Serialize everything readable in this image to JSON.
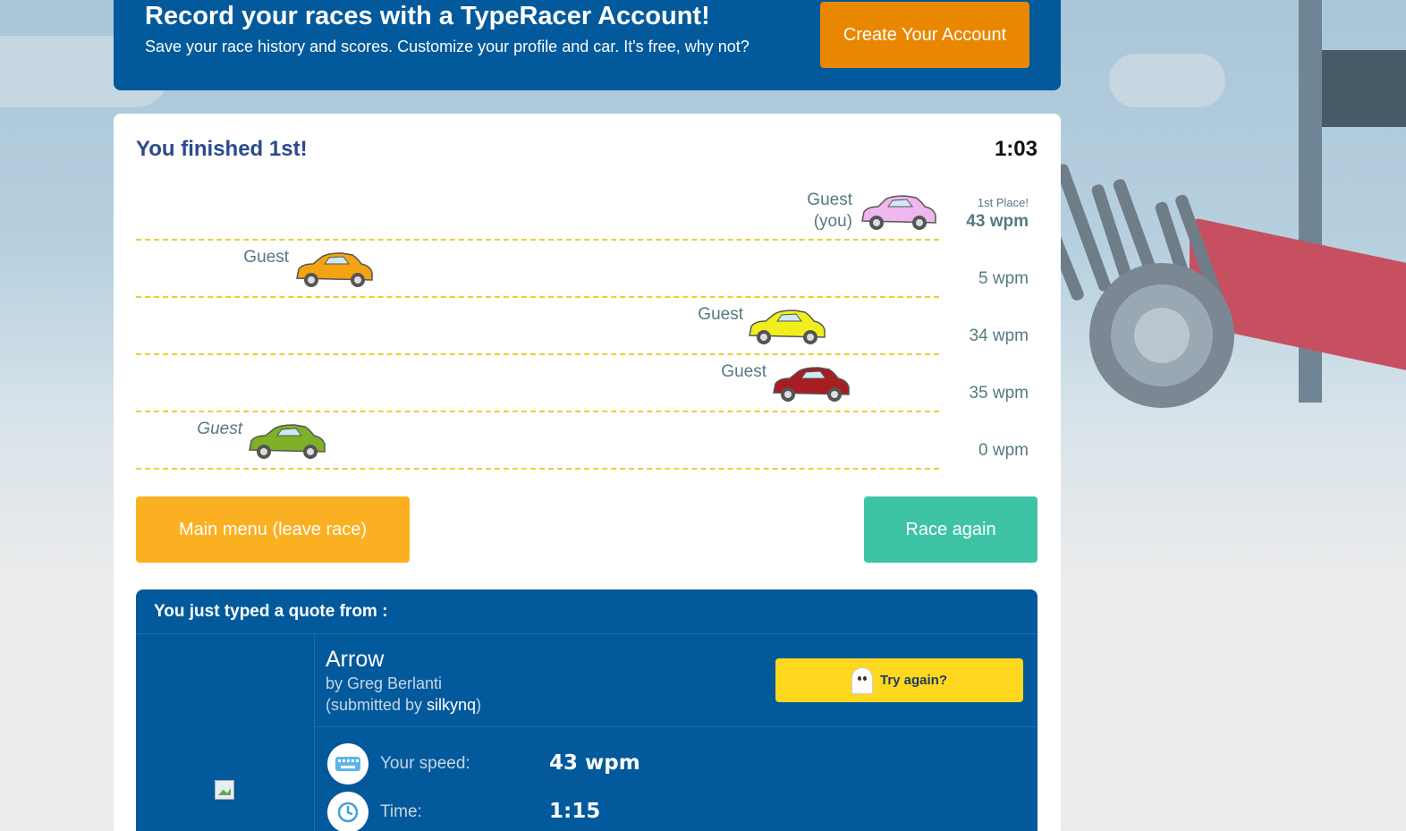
{
  "banner": {
    "title": "Record your races with a TypeRacer Account!",
    "subtitle": "Save your race history and scores. Customize your profile and car. It's free, why not?",
    "create_label": "Create Your Account"
  },
  "race": {
    "result": "You finished 1st!",
    "timer": "1:03",
    "racers": [
      {
        "name_line1": "Guest",
        "name_line2": "(you)",
        "place": "1st Place!",
        "wpm": "43 wpm",
        "car": "pink-car-icon",
        "color": "#f0b7ef",
        "progress": 1.0
      },
      {
        "name_line1": "Guest",
        "name_line2": "",
        "place": "",
        "wpm": "5 wpm",
        "car": "orange-car-icon",
        "color": "#f5a313",
        "progress": 0.2
      },
      {
        "name_line1": "Guest",
        "name_line2": "",
        "place": "",
        "wpm": "34 wpm",
        "car": "yellow-car-icon",
        "color": "#f1ef1b",
        "progress": 0.8
      },
      {
        "name_line1": "Guest",
        "name_line2": "",
        "place": "",
        "wpm": "35 wpm",
        "car": "red-car-icon",
        "color": "#a71d22",
        "progress": 0.83
      },
      {
        "name_line1": "Guest",
        "name_line2": "",
        "place": "",
        "wpm": "0 wpm",
        "car": "green-car-icon",
        "color": "#7eb128",
        "progress": 0.14
      }
    ]
  },
  "actions": {
    "main_menu": "Main menu (leave race)",
    "race_again": "Race again"
  },
  "quote": {
    "heading": "You just typed a quote from :",
    "title": "Arrow",
    "by": "by Greg Berlanti",
    "submitted_prefix": "(submitted by ",
    "submitted_user": "silkynq",
    "submitted_suffix": ")",
    "try_again": "Try again?",
    "stats": [
      {
        "label": "Your speed:",
        "value": "43 wpm",
        "icon": "keyboard-icon"
      },
      {
        "label": "Time:",
        "value": "1:15",
        "icon": "clock-icon"
      }
    ]
  }
}
